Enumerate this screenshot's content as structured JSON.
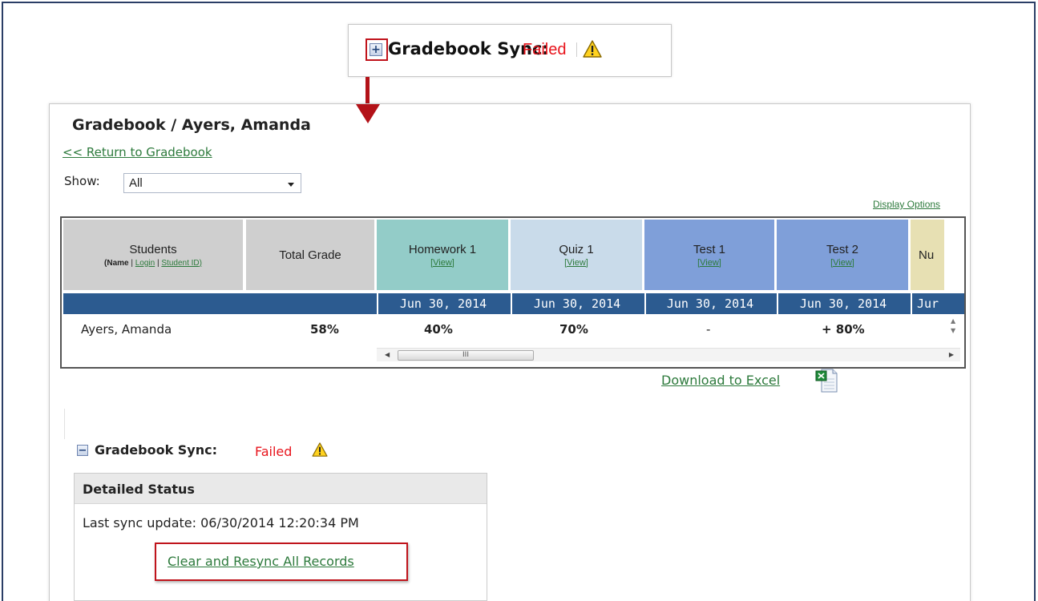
{
  "sync_top": {
    "label": "Gradebook Sync:",
    "status": "Failed"
  },
  "page": {
    "title": "Gradebook / Ayers, Amanda",
    "return_link": "<< Return to Gradebook",
    "show_label": "Show:",
    "show_value": "All",
    "display_options": "Display Options"
  },
  "grid": {
    "columns": [
      {
        "title": "Students",
        "sub_name": "(Name",
        "sub_login": "Login",
        "sub_id": "Student ID)",
        "sep": " | "
      },
      {
        "title": "Total Grade"
      },
      {
        "title": "Homework 1",
        "view": "[View]",
        "date": "Jun 30, 2014"
      },
      {
        "title": "Quiz 1",
        "view": "[View]",
        "date": "Jun 30, 2014"
      },
      {
        "title": "Test 1",
        "view": "[View]",
        "date": "Jun 30, 2014"
      },
      {
        "title": "Test 2",
        "view": "[View]",
        "date": "Jun 30, 2014"
      },
      {
        "title": "Nu",
        "view": "",
        "date": "Jur"
      }
    ],
    "row": {
      "student": "Ayers, Amanda",
      "total": "58%",
      "homework1": "40%",
      "quiz1": "70%",
      "test1": "-",
      "test2": "+ 80%"
    },
    "scroll_thumb": "III"
  },
  "download_label": "Download to Excel",
  "sync_bottom": {
    "label": "Gradebook Sync:",
    "status": "Failed"
  },
  "detailed_status": {
    "header": "Detailed Status",
    "last_sync": "Last sync update: 06/30/2014 12:20:34 PM",
    "resync_link": "Clear and Resync All Records"
  },
  "colors": {
    "failed": "#e8141c",
    "link": "#2d7a3c",
    "highlight": "#c0141c",
    "date_bar": "#2c5b90",
    "col_students": "#cfcfcf",
    "col_homework": "#93ccc8",
    "col_quiz": "#c9dbea",
    "col_test": "#7f9fd9",
    "col_next": "#e7e0b3"
  },
  "icons": [
    "plus-icon",
    "warning-icon",
    "minus-icon",
    "excel-icon",
    "arrow-down-icon"
  ]
}
